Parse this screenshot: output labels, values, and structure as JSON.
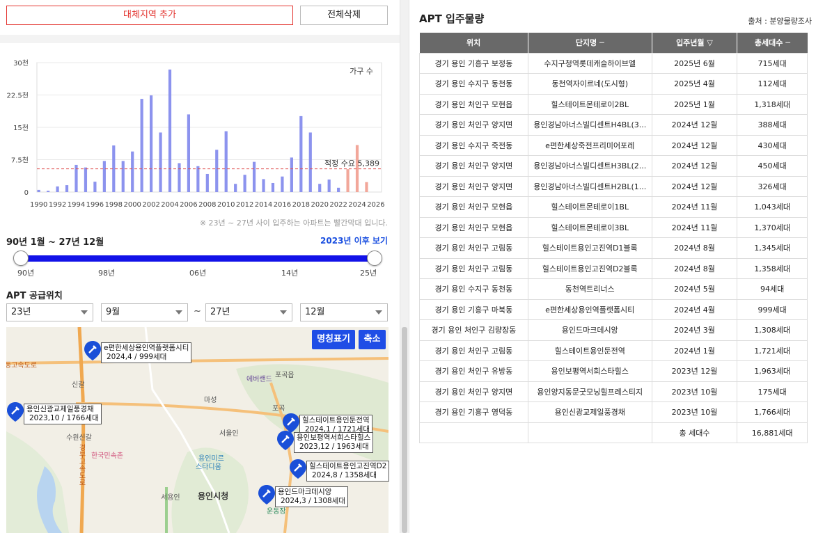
{
  "buttons": {
    "add_region": "대체지역 추가",
    "clear_all": "전체삭제"
  },
  "chart_data": {
    "type": "bar",
    "title": "",
    "ylabel": "가구 수",
    "ylim": [
      0,
      30000
    ],
    "yticks": [
      "0",
      "7.5천",
      "15천",
      "22.5천",
      "30천"
    ],
    "xticks": [
      "1990",
      "1992",
      "1994",
      "1996",
      "1998",
      "2000",
      "2002",
      "2004",
      "2006",
      "2008",
      "2010",
      "2012",
      "2014",
      "2016",
      "2018",
      "2020",
      "2022",
      "2024",
      "2026"
    ],
    "x": [
      1990,
      1991,
      1992,
      1993,
      1994,
      1995,
      1996,
      1997,
      1998,
      1999,
      2000,
      2001,
      2002,
      2003,
      2004,
      2005,
      2006,
      2007,
      2008,
      2009,
      2010,
      2011,
      2012,
      2013,
      2014,
      2015,
      2016,
      2017,
      2018,
      2019,
      2020,
      2021,
      2022,
      2023,
      2024,
      2025
    ],
    "values": [
      500,
      300,
      1300,
      1600,
      6300,
      5700,
      2400,
      7200,
      10800,
      7200,
      9400,
      21600,
      22400,
      13800,
      28400,
      6700,
      18000,
      6000,
      4200,
      9800,
      14100,
      1900,
      4000,
      7000,
      3000,
      2100,
      3600,
      8000,
      17600,
      13800,
      1900,
      2900,
      1000,
      5300,
      10900,
      2300
    ],
    "bar_colors": {
      "normal": "#8c93ee",
      "highlight": "#f2a79a"
    },
    "highlight_from": 2023,
    "reference_line": {
      "label": "적정 수요",
      "value": 5389,
      "value_text": "5,389",
      "color": "#e05050"
    },
    "note": "※ 23년 ~ 27년 사이 입주하는 아파트는 빨간막대 입니다."
  },
  "range": {
    "label": "90년 1월 ~ 27년 12월",
    "after_link": "2023년 이후 보기",
    "ticks": [
      "90년",
      "98년",
      "06년",
      "14년",
      "25년"
    ]
  },
  "supply": {
    "title": "APT 공급위치",
    "from_year": "23년",
    "from_month": "9월",
    "to_year": "27년",
    "to_month": "12월",
    "tilde": "~"
  },
  "map": {
    "btn_names": "명칭표기",
    "btn_zoom_out": "축소",
    "places": [
      "신갈",
      "에버랜드",
      "포곡읍",
      "마성",
      "포곡",
      "서울인",
      "수원신갈",
      "한국민속촌",
      "용인미르",
      "스타디움",
      "용인시청",
      "서용인",
      "동고속도로",
      "경부고속도로",
      "운동장"
    ],
    "markers": [
      {
        "name": "e편한세상용인역플랫폼시티",
        "info": "2024,4 / 999세대"
      },
      {
        "name": "용인신광교제일풍경채",
        "info": "2023,10 / 1766세대"
      },
      {
        "name": "힐스테이트용인둔전역",
        "info": "2024,1 / 1721세대"
      },
      {
        "name": "용인보평역서희스타힐스",
        "info": "2023,12 / 1963세대"
      },
      {
        "name": "힐스테이트용인고진역D2",
        "info": "2024,8 / 1358세대"
      },
      {
        "name": "용인드마크데시앙",
        "info": "2024,3 / 1308세대"
      }
    ]
  },
  "table": {
    "title": "APT 입주물량",
    "source": "출처 : 분양물량조사",
    "headers": [
      "위치",
      "단지명 ─",
      "입주년월 ▽",
      "총세대수 ─"
    ],
    "rows": [
      [
        "경기 용인 기흥구 보정동",
        "수지구청역롯데캐슬하이브엘",
        "2025년 6월",
        "715세대"
      ],
      [
        "경기 용인 수지구 동천동",
        "동천역자이르네(도시형)",
        "2025년 4월",
        "112세대"
      ],
      [
        "경기 용인 처인구 모현읍",
        "힐스테이트몬테로이2BL",
        "2025년 1월",
        "1,318세대"
      ],
      [
        "경기 용인 처인구 양지면",
        "용인경남아너스빌디센트H4BL(3...",
        "2024년 12월",
        "388세대"
      ],
      [
        "경기 용인 수지구 죽전동",
        "e편한세상죽전프리미어포레",
        "2024년 12월",
        "430세대"
      ],
      [
        "경기 용인 처인구 양지면",
        "용인경남아너스빌디센트H3BL(2...",
        "2024년 12월",
        "450세대"
      ],
      [
        "경기 용인 처인구 양지면",
        "용인경남아너스빌디센트H2BL(1...",
        "2024년 12월",
        "326세대"
      ],
      [
        "경기 용인 처인구 모현읍",
        "힐스테이트몬테로이1BL",
        "2024년 11월",
        "1,043세대"
      ],
      [
        "경기 용인 처인구 모현읍",
        "힐스테이트몬테로이3BL",
        "2024년 11월",
        "1,370세대"
      ],
      [
        "경기 용인 처인구 고림동",
        "힐스테이트용인고진역D1블록",
        "2024년 8월",
        "1,345세대"
      ],
      [
        "경기 용인 처인구 고림동",
        "힐스테이트용인고진역D2블록",
        "2024년 8월",
        "1,358세대"
      ],
      [
        "경기 용인 수지구 동천동",
        "동천역트리너스",
        "2024년 5월",
        "94세대"
      ],
      [
        "경기 용인 기흥구 마북동",
        "e편한세상용인역플랫폼시티",
        "2024년 4월",
        "999세대"
      ],
      [
        "경기 용인 처인구 김량장동",
        "용인드마크데시앙",
        "2024년 3월",
        "1,308세대"
      ],
      [
        "경기 용인 처인구 고림동",
        "힐스테이트용인둔전역",
        "2024년 1월",
        "1,721세대"
      ],
      [
        "경기 용인 처인구 유방동",
        "용인보평역서희스타힐스",
        "2023년 12월",
        "1,963세대"
      ],
      [
        "경기 용인 처인구 양지면",
        "용인양지동문굿모닝힐프레스티지",
        "2023년 10월",
        "175세대"
      ],
      [
        "경기 용인 기흥구 영덕동",
        "용인신광교제일풍경채",
        "2023년 10월",
        "1,766세대"
      ]
    ],
    "total_label": "총 세대수",
    "total_value": "16,881세대"
  }
}
